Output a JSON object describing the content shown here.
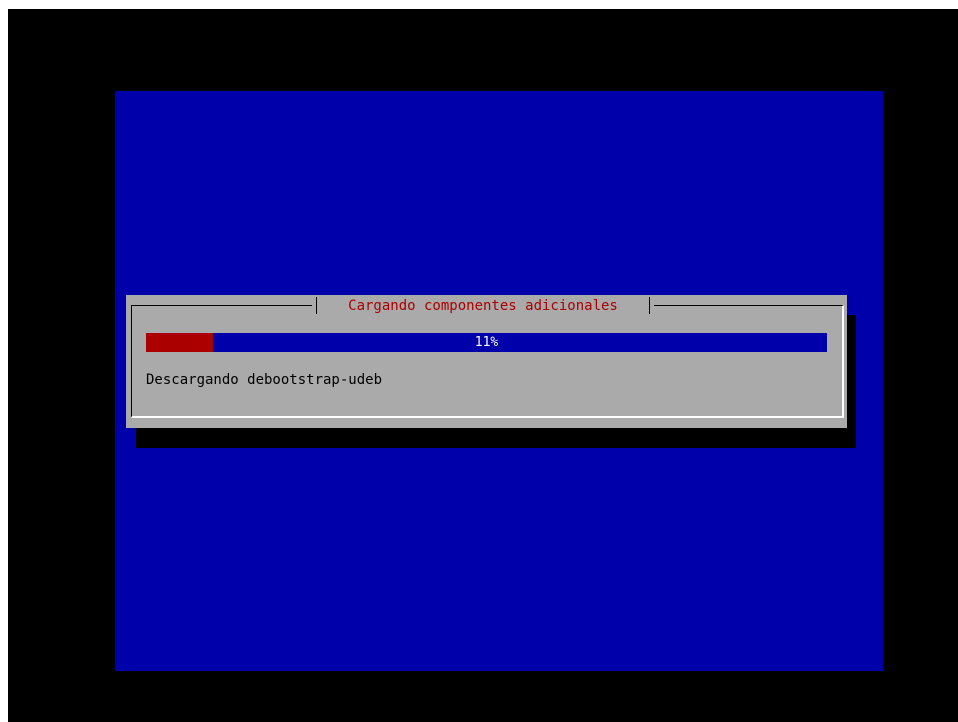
{
  "installer": {
    "dialog": {
      "title": "Cargando componentes adicionales",
      "progress": {
        "percent": 11,
        "label": "11%"
      },
      "status": "Descargando debootstrap-udeb"
    }
  },
  "colors": {
    "screen_background": "#000000",
    "desktop": "#0000aa",
    "dialog": "#aaaaaa",
    "title_text": "#aa0000",
    "progress_fill": "#aa0000",
    "progress_track": "#0000aa",
    "progress_text": "#ffffff"
  }
}
